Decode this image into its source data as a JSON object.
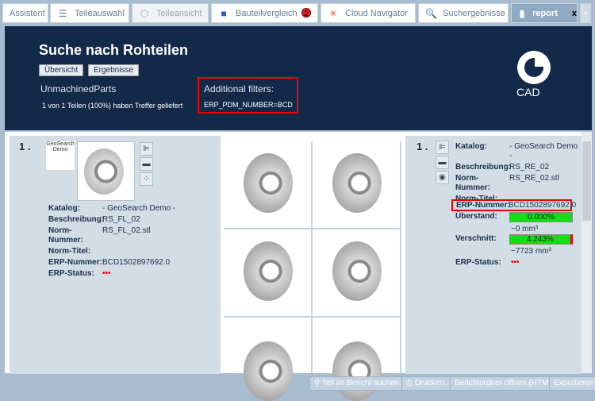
{
  "tabs": [
    {
      "label": "Assistent",
      "icon": "none"
    },
    {
      "label": "Teileauswahl",
      "icon": "stack-icon"
    },
    {
      "label": "Teileansicht",
      "icon": "cubes-icon"
    },
    {
      "label": "Bauteilvergleich",
      "icon": "compare-icon",
      "badge": "2"
    },
    {
      "label": "Cloud Navigator",
      "icon": "network-icon"
    },
    {
      "label": "Suchergebnisse",
      "icon": "search-icon"
    },
    {
      "label": "report",
      "icon": "chart-icon",
      "close": "x"
    }
  ],
  "header": {
    "title": "Suche nach Rohteilen",
    "buttons": [
      "Übersicht",
      "Ergebnisse"
    ],
    "catalog": "UnmachinedParts",
    "count": "1 von 1 Teilen (100%) haben Treffer geliefert",
    "filters_title": "Additional filters:",
    "filter": "ERP_PDM_NUMBER=BCD",
    "logo": "CADENAS"
  },
  "left": {
    "rank": "1 .",
    "thumb_label": "GeoSearch Demo",
    "props": [
      [
        "Katalog:",
        "- GeoSearch Demo -"
      ],
      [
        "Beschreibung:",
        "RS_FL_02"
      ],
      [
        "Norm-Nummer:",
        "RS_FL_02.stl"
      ],
      [
        "Norm-Titel:",
        ""
      ],
      [
        "ERP-Nummer:",
        "BCD1502897692.0"
      ],
      [
        "ERP-Status:",
        "•••"
      ]
    ]
  },
  "right": {
    "rank": "1 .",
    "props": [
      [
        "Katalog:",
        "- GeoSearch Demo -"
      ],
      [
        "Beschreibung:",
        "RS_RE_02"
      ],
      [
        "Norm-Nummer:",
        "RS_RE_02.stl"
      ],
      [
        "Norm-Titel:",
        ""
      ],
      [
        "ERP-Nummer:",
        "BCD1502897692.0"
      ]
    ],
    "ueberstand_label": "Überstand:",
    "ueberstand": "0.000%",
    "ueberstand_vol": "~0 mm³",
    "verschnitt_label": "Verschnitt:",
    "verschnitt": "4.243%",
    "verschnitt_vol": "~7723 mm³",
    "status_label": "ERP-Status:",
    "status": "•••"
  },
  "footer": [
    "Teil im Bericht suchen...",
    "Drucken...",
    "Berichtordner öffnen (HTML)",
    "Exportieren"
  ],
  "colors": {
    "header": "#13294a",
    "highlight": "#e00000",
    "bar": "#10e010"
  }
}
